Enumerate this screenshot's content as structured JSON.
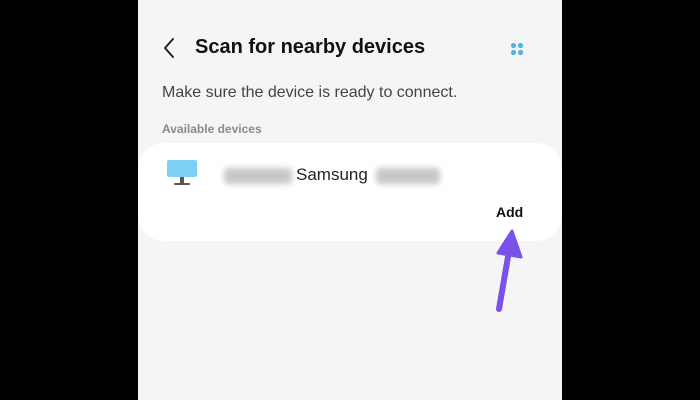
{
  "header": {
    "title": "Scan for nearby devices",
    "back_icon": "back-arrow-icon",
    "menu_icon": "more-options-dots-icon"
  },
  "subtitle": "Make sure the device is ready to connect.",
  "section_label": "Available devices",
  "devices": [
    {
      "icon": "monitor-icon",
      "name": "Samsung",
      "action_label": "Add"
    }
  ],
  "colors": {
    "screen_background": "#f5f5f5",
    "card_background": "#ffffff",
    "monitor_icon": "#7fd0f5",
    "menu_dots": "#4fb5e3",
    "annotation_arrow": "#7a52e8"
  }
}
